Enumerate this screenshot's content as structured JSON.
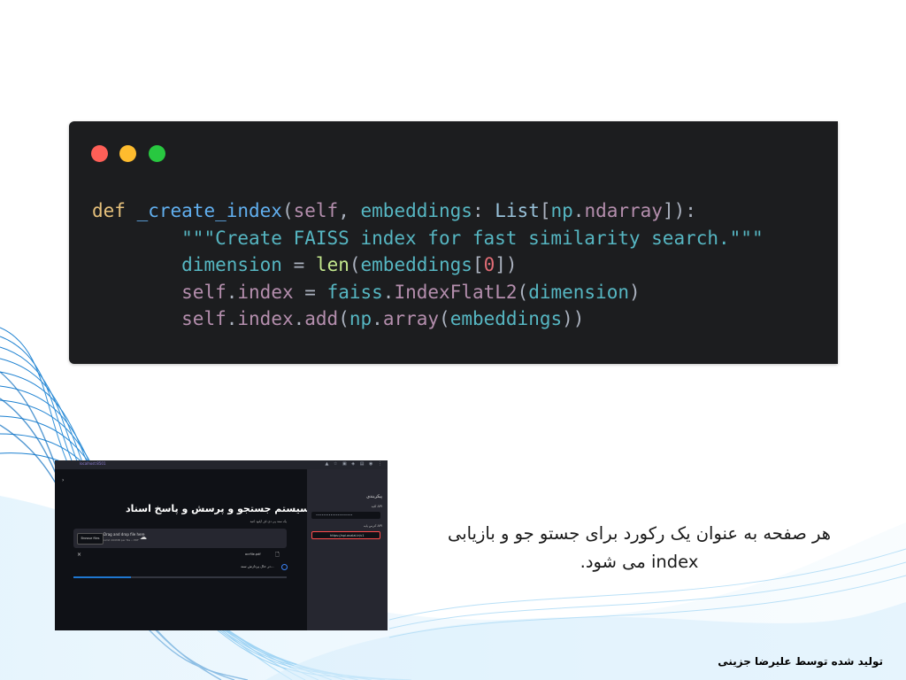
{
  "code": {
    "language": "python",
    "lines": [
      "def _create_index(self, embeddings: List[np.ndarray]):",
      "        \"\"\"Create FAISS index for fast similarity search.\"\"\"",
      "        dimension = len(embeddings[0])",
      "        self.index = faiss.IndexFlatL2(dimension)",
      "        self.index.add(np.array(embeddings))"
    ]
  },
  "colors": {
    "code_bg": "#1c1d1f",
    "traffic_red": "#ff5f57",
    "traffic_yellow": "#febc2e",
    "traffic_green": "#28c840",
    "wave_blue": "#1f8fd6"
  },
  "app_screenshot": {
    "tab_title": "localhost:8501",
    "title": "سیستم جستجو و پرسش و پاسخ اسناد",
    "subtitle": "یک سند پی دی اف آپلود کنید",
    "upload": {
      "browse_label": "Browse files",
      "drop_text": "Drag and drop file here",
      "limit_text": "Limit 200MB per file • PDF"
    },
    "file_name": "ocrfile.pdf",
    "processing_text": "در حال پردازش سند...",
    "progress": 0.27,
    "sidebar": {
      "title": "پیکربندی",
      "api_key_label": "کلید API",
      "api_key_value": "••••••••••••••••••••",
      "url_label": "آدرس پایه API",
      "url_value": "https://api.avalai.ir/v1"
    }
  },
  "caption": {
    "text": "هر صفحه به عنوان یک رکورد برای جستو جو و بازیابی index می شود."
  },
  "footer": {
    "credit": "تولید شده توسط علیرضا جزینی"
  }
}
